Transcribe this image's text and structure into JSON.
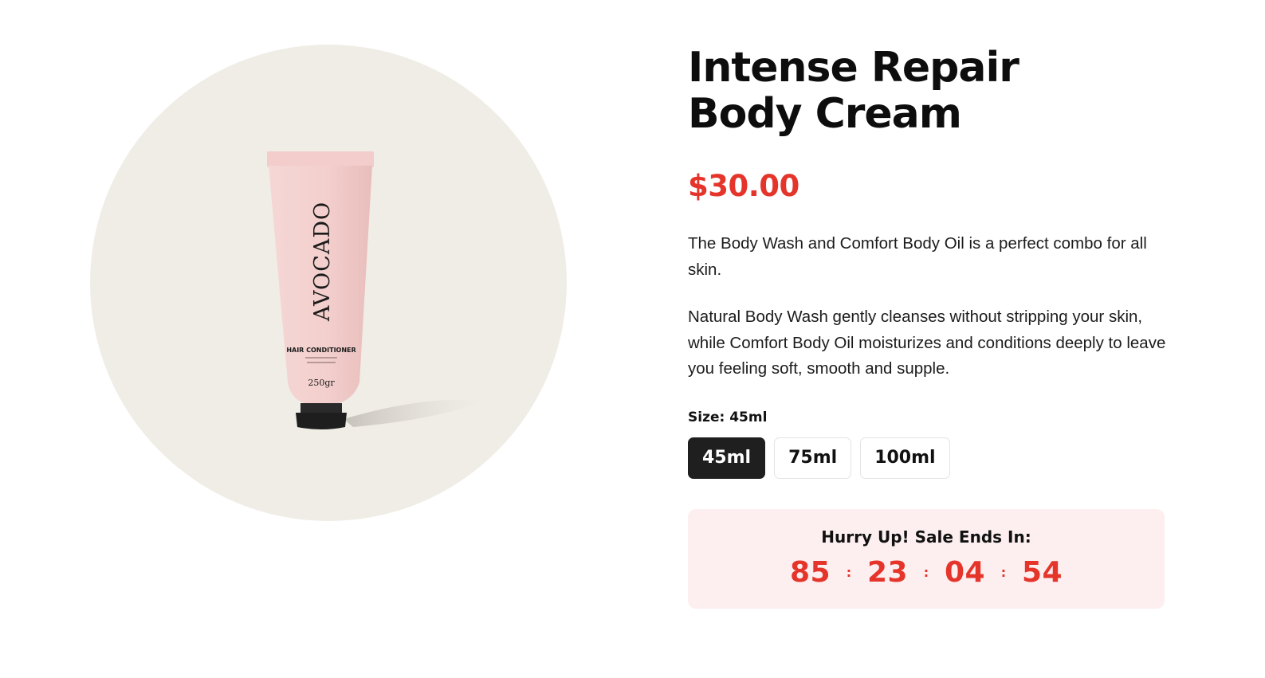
{
  "product": {
    "title_line1": "Intense Repair",
    "title_line2": "Body Cream",
    "price": "$30.00",
    "description_1": "The Body Wash and Comfort Body Oil is a perfect combo for all skin.",
    "description_2": "Natural Body Wash gently cleanses without stripping your skin, while Comfort Body Oil moisturizes and conditions deeply to leave you feeling soft, smooth and supple.",
    "image": {
      "brand": "AVOCADO",
      "line": "HAIR CONDITIONER",
      "weight": "250gr",
      "background_color": "#f0ede6",
      "tube_color": "#f3cfcd"
    }
  },
  "size_selector": {
    "label": "Size:",
    "selected": "45ml",
    "options": [
      "45ml",
      "75ml",
      "100ml"
    ]
  },
  "sale": {
    "heading": "Hurry Up! Sale Ends In:",
    "countdown": [
      "85",
      "23",
      "04",
      "54"
    ],
    "separator": ":",
    "accent_color": "#e5352b",
    "box_color": "#fdeff0"
  }
}
